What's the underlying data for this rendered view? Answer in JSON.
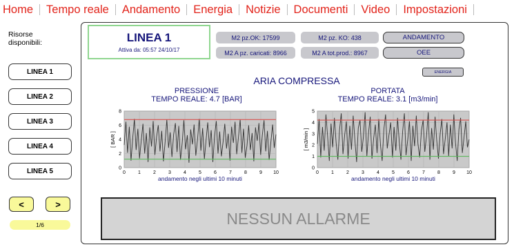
{
  "nav": {
    "items": [
      "Home",
      "Tempo reale",
      "Andamento",
      "Energia",
      "Notizie",
      "Documenti",
      "Video",
      "Impostazioni"
    ]
  },
  "sidebar": {
    "title_line1": "Risorse",
    "title_line2": "disponibili:",
    "lines": [
      "LINEA 1",
      "LINEA 2",
      "LINEA 3",
      "LINEA 4",
      "LINEA 5"
    ],
    "prev_label": "<",
    "next_label": ">",
    "page_indicator": "1/6"
  },
  "line": {
    "title": "LINEA 1",
    "active_since": "Attiva da: 05:57 24/10/17"
  },
  "stats": {
    "pz_ok": "M2 pz.OK: 17599",
    "pz_ko": "M2 pz. KO: 438",
    "pz_caricati": "M2 A pz. caricati: 8966",
    "tot_prod": "M2 A tot.prod.: 8967"
  },
  "buttons": {
    "andamento": "ANDAMENTO",
    "oee": "OEE",
    "energia": "ENERGIA"
  },
  "section": {
    "title": "ARIA COMPRESSA"
  },
  "charts": {
    "pressione": {
      "title": "PRESSIONE",
      "realtime": "TEMPO REALE: 4.7 [BAR]"
    },
    "portata": {
      "title": "PORTATA",
      "realtime": "TEMPO REALE: 3.1 [m3/min]"
    }
  },
  "alarm": {
    "text": "NESSUN ALLARME"
  },
  "colors": {
    "nav": "#e2231a",
    "text_blue": "#15157a",
    "highlight": "#8fd68f",
    "button_yellow": "#f9f99a",
    "plot_bg": "#c9c9c9",
    "upper_limit": "#d9534f",
    "lower_limit": "#5cb85c"
  },
  "chart_data": [
    {
      "type": "line",
      "title": "",
      "xlabel": "andamento negli ultimi 10 minuti",
      "ylabel": "[ BAR ]",
      "xlim": [
        0,
        10
      ],
      "ylim": [
        0,
        8
      ],
      "x_ticks": [
        0,
        1,
        2,
        3,
        4,
        5,
        6,
        7,
        8,
        9,
        10
      ],
      "y_ticks": [
        0,
        2,
        4,
        6,
        8
      ],
      "grid": true,
      "series": [
        {
          "name": "",
          "color": "#333333",
          "values": [
            3.2,
            6.5,
            2.1,
            5.8,
            1.0,
            4.2,
            6.9,
            2.5,
            5.5,
            1.3,
            3.8,
            6.2,
            2.0,
            4.9,
            0.8,
            5.7,
            3.0,
            6.6,
            1.8,
            4.4,
            6.0,
            2.3,
            5.2,
            0.9,
            3.6,
            6.8,
            2.8,
            5.0,
            1.5,
            4.7,
            6.3,
            2.2,
            5.9,
            1.1,
            3.4,
            6.7,
            2.6,
            4.6,
            0.7,
            5.4,
            3.3,
            6.1,
            1.7,
            4.0,
            6.9,
            2.4,
            5.6,
            1.2,
            3.9,
            6.4,
            2.9,
            5.3,
            0.8,
            4.5,
            6.6,
            2.0,
            5.1,
            1.6,
            3.7,
            6.2,
            2.7,
            4.8,
            1.0,
            5.8,
            3.5,
            6.5,
            1.9,
            4.3,
            6.8,
            2.1,
            5.5,
            1.4,
            3.1,
            6.0,
            2.5,
            4.9,
            0.9,
            5.7,
            3.8,
            6.3,
            1.8,
            4.6,
            6.7,
            2.3,
            5.2,
            1.1,
            3.6,
            6.1,
            2.8,
            4.7
          ]
        },
        {
          "name": "",
          "color": "#d9534f",
          "values": [
            6.8,
            6.8
          ]
        },
        {
          "name": "",
          "color": "#5cb85c",
          "values": [
            1.2,
            1.2
          ]
        }
      ]
    },
    {
      "type": "line",
      "title": "",
      "xlabel": "andamento negli ultimi 10 minuti",
      "ylabel": "[ m3/min ]",
      "xlim": [
        0,
        10
      ],
      "ylim": [
        0,
        5
      ],
      "x_ticks": [
        0,
        1,
        2,
        3,
        4,
        5,
        6,
        7,
        8,
        9,
        10
      ],
      "y_ticks": [
        0,
        1,
        2,
        3,
        4,
        5
      ],
      "grid": true,
      "series": [
        {
          "name": "",
          "color": "#333333",
          "values": [
            2.1,
            4.3,
            0.9,
            3.6,
            1.5,
            4.7,
            2.8,
            0.6,
            3.9,
            1.8,
            4.4,
            2.2,
            0.7,
            3.3,
            4.8,
            1.2,
            2.9,
            4.1,
            0.8,
            3.7,
            1.6,
            4.6,
            2.4,
            0.5,
            3.5,
            4.2,
            1.4,
            2.7,
            4.9,
            1.0,
            3.1,
            4.5,
            0.8,
            2.6,
            3.8,
            1.3,
            4.3,
            2.0,
            0.6,
            3.4,
            4.7,
            1.7,
            2.9,
            4.0,
            0.9,
            3.6,
            1.5,
            4.4,
            2.3,
            0.7,
            3.2,
            4.8,
            1.1,
            2.5,
            4.1,
            0.6,
            3.7,
            1.9,
            4.6,
            2.1,
            0.9,
            3.3,
            4.2,
            1.4,
            2.8,
            4.9,
            0.7,
            3.5,
            1.6,
            4.5,
            2.4,
            0.8,
            3.0,
            4.3,
            1.2,
            2.6,
            4.0,
            1.0,
            3.8,
            1.7,
            4.7,
            2.2,
            0.6,
            3.4,
            4.4,
            1.3,
            2.7,
            4.1,
            1.8,
            2.5
          ]
        },
        {
          "name": "",
          "color": "#d9534f",
          "values": [
            4.2,
            4.2
          ]
        },
        {
          "name": "",
          "color": "#5cb85c",
          "values": [
            1.0,
            1.0
          ]
        }
      ]
    }
  ]
}
